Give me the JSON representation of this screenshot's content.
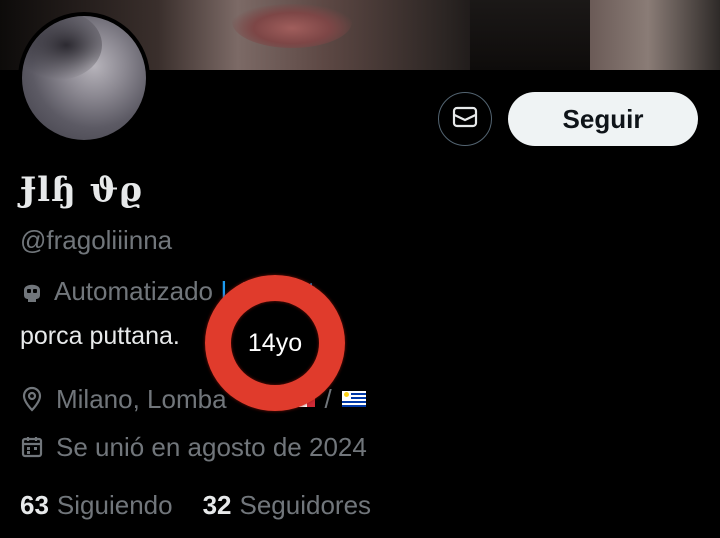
{
  "profile": {
    "display_name": "Ɉlɧ ϑϱ",
    "handle": "@fragoliiinna",
    "automated_label": "Automatizado",
    "automated_by": "l_Martttt",
    "bio": "porca puttana.",
    "age_text": "14yo",
    "location": "Milano, Lomba",
    "location_separator": "/",
    "joined": "Se unió en agosto de 2024"
  },
  "actions": {
    "message_icon": "envelope-icon",
    "follow_label": "Seguir"
  },
  "stats": {
    "following_count": "63",
    "following_label": "Siguiendo",
    "followers_count": "32",
    "followers_label": "Seguidores"
  },
  "icons": {
    "automated": "robot-icon",
    "location": "location-pin-icon",
    "joined": "calendar-icon"
  },
  "colors": {
    "background": "#000000",
    "primary_text": "#e7e9ea",
    "secondary_text": "#71767b",
    "link": "#1d9bf0",
    "follow_button_bg": "#eff3f4",
    "annotation_ring": "#e03b2c"
  }
}
